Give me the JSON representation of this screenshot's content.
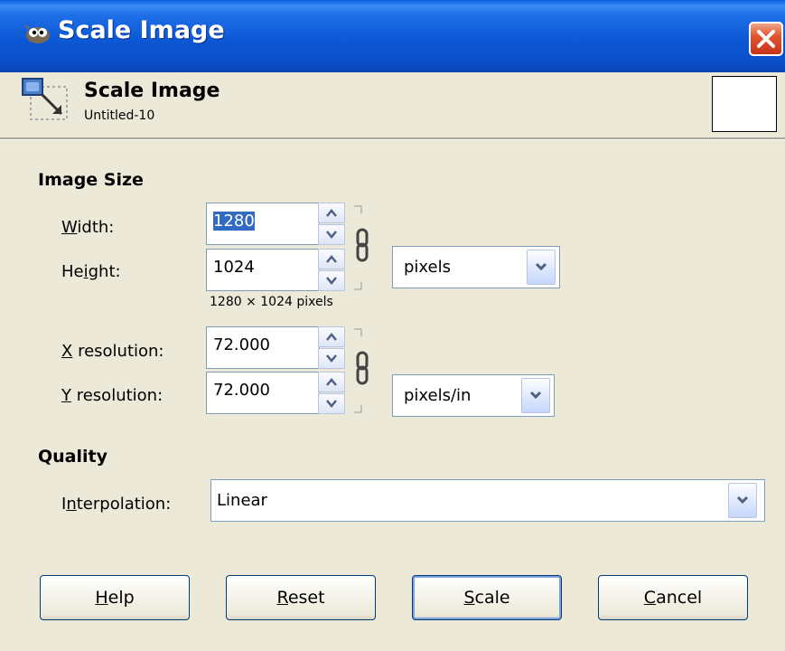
{
  "window": {
    "title": "Scale Image"
  },
  "header": {
    "title": "Scale Image",
    "subtitle": "Untitled-10"
  },
  "image_size": {
    "section_label": "Image Size",
    "width": {
      "label_ul": "W",
      "label_rest": "idth:",
      "value": "1280"
    },
    "height": {
      "label_a": "He",
      "label_ul": "i",
      "label_b": "ght:",
      "value": "1024"
    },
    "unit": "pixels",
    "dimensions_text": "1280 × 1024 pixels",
    "x_res": {
      "label_ul": "X",
      "label_rest": " resolution:",
      "value": "72.000"
    },
    "y_res": {
      "label_ul": "Y",
      "label_rest": " resolution:",
      "value": "72.000"
    },
    "res_unit": "pixels/in"
  },
  "quality": {
    "section_label": "Quality",
    "interp": {
      "label_a": "I",
      "label_ul": "n",
      "label_b": "terpolation:",
      "value": "Linear"
    }
  },
  "buttons": {
    "help": {
      "ul": "H",
      "rest": "elp"
    },
    "reset": {
      "ul": "R",
      "rest": "eset"
    },
    "scale": {
      "ul": "S",
      "rest": "cale"
    },
    "cancel": {
      "ul": "C",
      "rest": "ancel"
    }
  },
  "colors": {
    "titlebar": "#0b56d2",
    "close": "#d8492a",
    "face": "#ece9d8",
    "selection": "#316ac5"
  }
}
